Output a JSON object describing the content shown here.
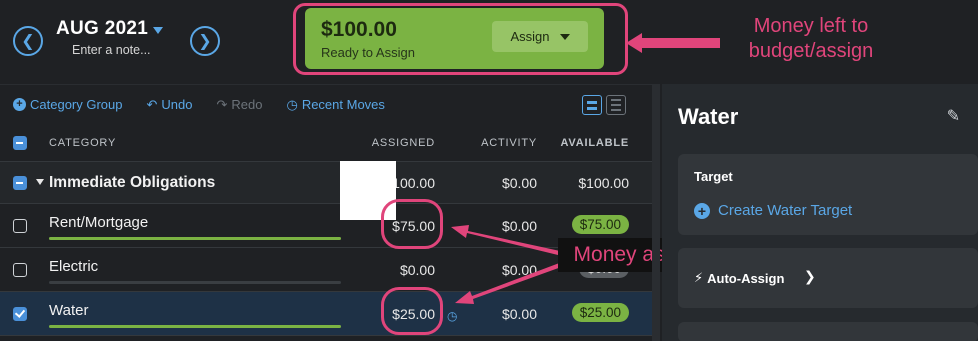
{
  "header": {
    "month": "AUG 2021",
    "note_placeholder": "Enter a note...",
    "ready_amount": "$100.00",
    "ready_label": "Ready to Assign",
    "assign_button": "Assign"
  },
  "annotations": {
    "money_left": "Money left to budget/assign",
    "money_assigned": "Money assigned"
  },
  "toolbar": {
    "category_group": "Category Group",
    "undo": "Undo",
    "redo": "Redo",
    "recent_moves": "Recent Moves"
  },
  "table": {
    "headers": {
      "category": "CATEGORY",
      "assigned": "ASSIGNED",
      "activity": "ACTIVITY",
      "available": "AVAILABLE"
    },
    "group": {
      "name": "Immediate Obligations",
      "assigned": "100.00",
      "activity": "$0.00",
      "available": "$100.00"
    },
    "rows": [
      {
        "name": "Rent/Mortgage",
        "assigned": "$75.00",
        "activity": "$0.00",
        "available": "$75.00",
        "progress": 1.0
      },
      {
        "name": "Electric",
        "assigned": "$0.00",
        "activity": "$0.00",
        "available": "$0.00",
        "progress": 0.0
      },
      {
        "name": "Water",
        "assigned": "$25.00",
        "activity": "$0.00",
        "available": "$25.00",
        "progress": 1.0
      }
    ]
  },
  "panel": {
    "title": "Water",
    "target_heading": "Target",
    "create_target": "Create Water Target",
    "auto_assign": "Auto-Assign"
  },
  "colors": {
    "accent": "#5aa7e6",
    "green": "#7bb343",
    "annotation": "#e0457b"
  }
}
